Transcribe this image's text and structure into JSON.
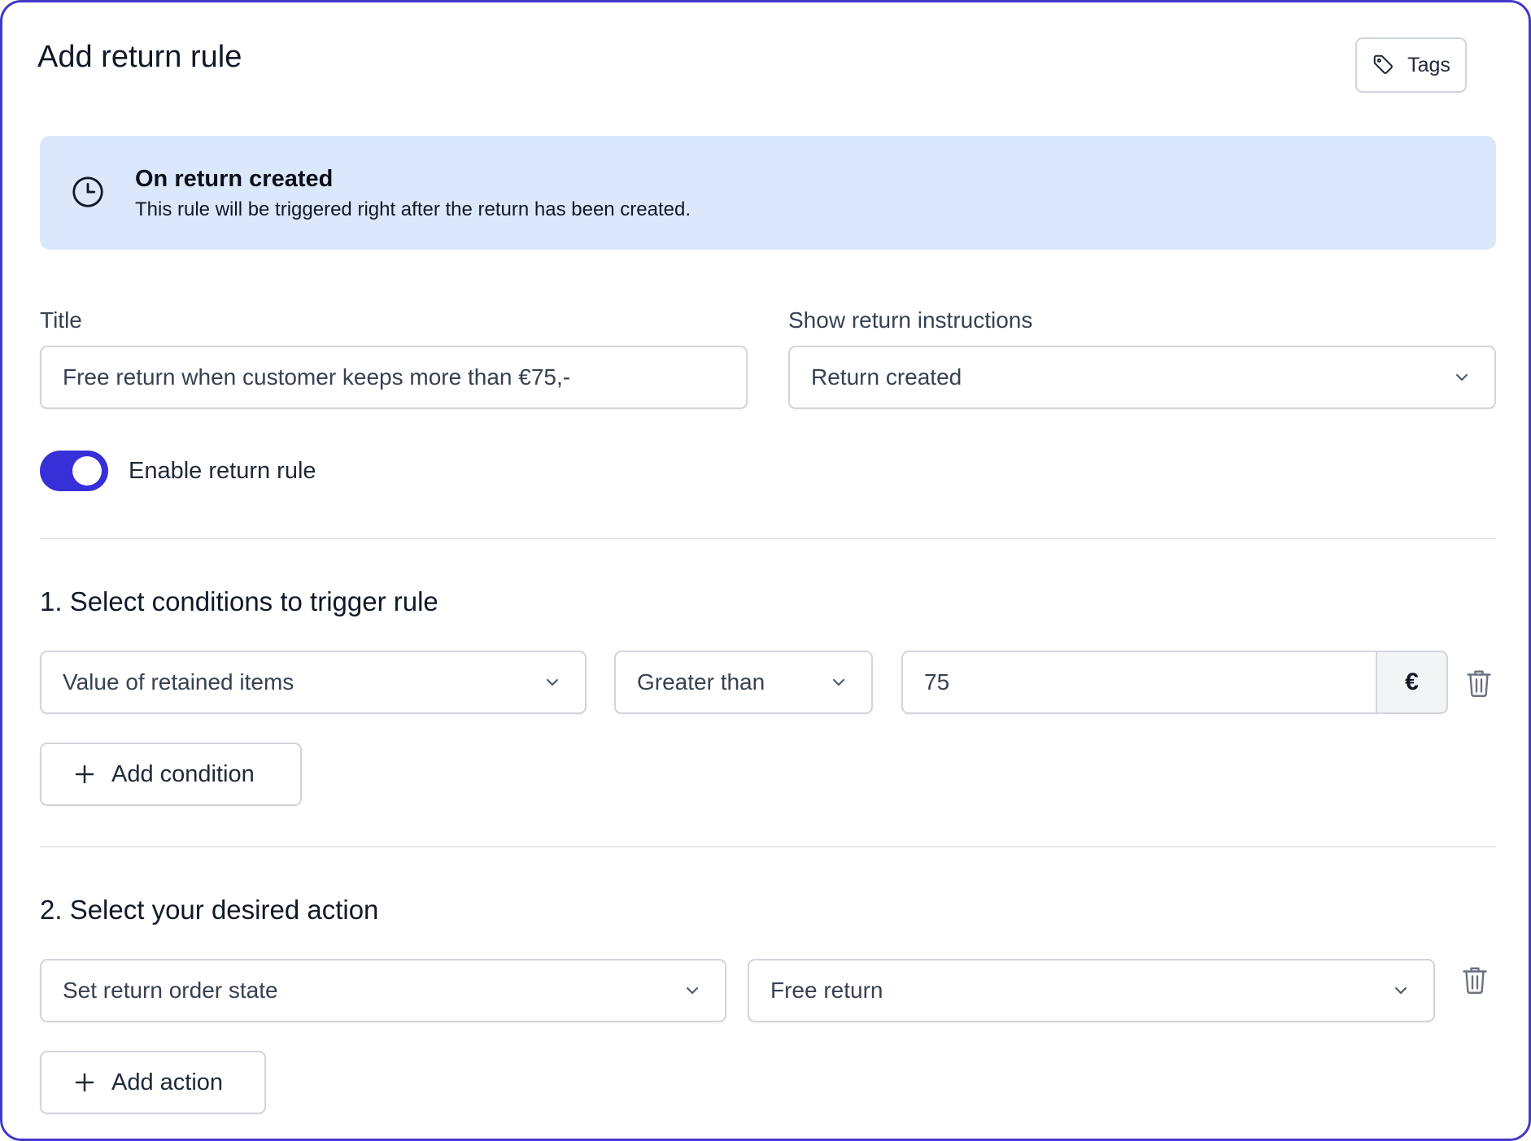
{
  "header": {
    "title": "Add return rule",
    "tags_label": "Tags"
  },
  "trigger_banner": {
    "icon": "clock-icon",
    "title": "On return created",
    "description": "This rule will be triggered right after the return has been created."
  },
  "form": {
    "title_label": "Title",
    "title_value": "Free return when customer keeps more than €75,-",
    "instructions_label": "Show return instructions",
    "instructions_value": "Return created",
    "enable_label": "Enable return rule",
    "enabled": true
  },
  "conditions": {
    "heading": "1. Select conditions to trigger rule",
    "rows": [
      {
        "field": "Value of retained items",
        "operator": "Greater than",
        "value": "75",
        "currency": "€"
      }
    ],
    "add_label": "Add condition"
  },
  "actions": {
    "heading": "2. Select your desired action",
    "rows": [
      {
        "action": "Set return order state",
        "value": "Free return"
      }
    ],
    "add_label": "Add action"
  },
  "colors": {
    "accent": "#3730d8",
    "frame_border": "#4338ca",
    "banner_bg": "#dbe8fc"
  }
}
